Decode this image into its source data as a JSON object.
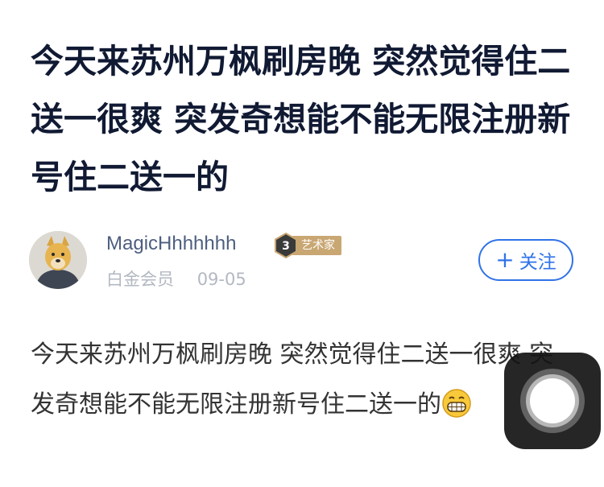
{
  "post": {
    "title": "今天来苏州万枫刷房晚 突然觉得住二送一很爽 突发奇想能不能无限注册新号住二送一的",
    "body": "今天来苏州万枫刷房晚 突然觉得住二送一很爽 突发奇想能不能无限注册新号住二送一的",
    "emoji": "grinning-face-emoji"
  },
  "author": {
    "name": "MagicHhhhhhh",
    "level": "3",
    "level_title": "艺术家",
    "membership": "白金会员",
    "date": "09-05"
  },
  "follow": {
    "label": "关注",
    "color": "#3073e8"
  },
  "colors": {
    "title": "#111a33",
    "author_name": "#4d5e80",
    "badge": "#c9a773"
  }
}
